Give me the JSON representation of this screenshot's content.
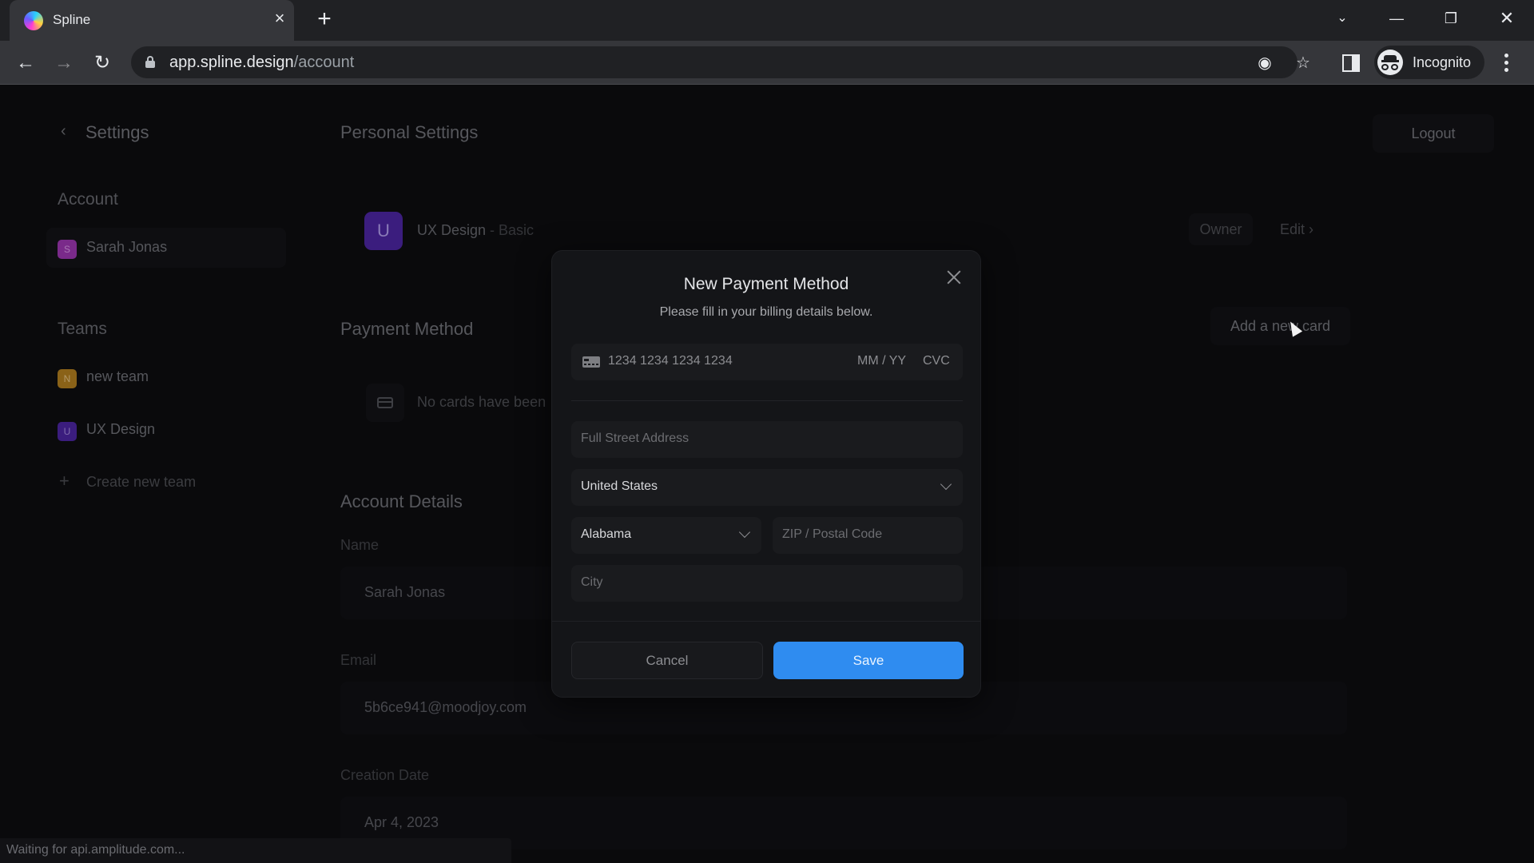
{
  "browser": {
    "tab_title": "Spline",
    "url_host": "app.spline.design",
    "url_path": "/account",
    "profile_label": "Incognito",
    "status_text": "Waiting for api.amplitude.com..."
  },
  "sidebar": {
    "title": "Settings",
    "account_heading": "Account",
    "account_items": [
      {
        "initial": "S",
        "label": "Sarah Jonas",
        "color": "#7a2a8a"
      }
    ],
    "teams_heading": "Teams",
    "team_items": [
      {
        "initial": "N",
        "label": "new team",
        "color": "#8a6218"
      },
      {
        "initial": "U",
        "label": "UX Design",
        "color": "#3b1d7e"
      }
    ],
    "create_team_label": "Create new team"
  },
  "header": {
    "logout_label": "Logout"
  },
  "personal_settings": {
    "heading": "Personal Settings",
    "team": {
      "initial": "U",
      "name": "UX Design",
      "plan": " - Basic",
      "role": "Owner",
      "edit_label": "Edit"
    }
  },
  "payment_method": {
    "heading": "Payment Method",
    "add_card_label": "Add a new card",
    "empty_text": "No cards have been"
  },
  "account_details": {
    "heading": "Account Details",
    "name_label": "Name",
    "name_value": "Sarah Jonas",
    "email_label": "Email",
    "email_value": "5b6ce941@moodjoy.com",
    "created_label": "Creation Date",
    "created_value": "Apr 4, 2023"
  },
  "modal": {
    "title": "New Payment Method",
    "subtitle": "Please fill in your billing details below.",
    "card_number_placeholder": "1234 1234 1234 1234",
    "expiry_placeholder": "MM / YY",
    "cvc_placeholder": "CVC",
    "street_placeholder": "Full Street Address",
    "country_value": "United States",
    "state_value": "Alabama",
    "zip_placeholder": "ZIP / Postal Code",
    "city_placeholder": "City",
    "cancel_label": "Cancel",
    "save_label": "Save",
    "accent_color": "#2f8cf0"
  }
}
